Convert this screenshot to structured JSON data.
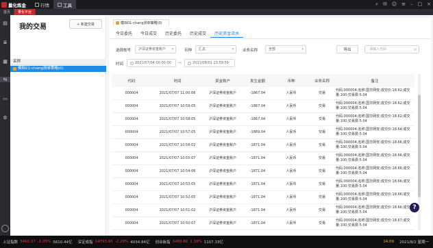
{
  "app": {
    "name": "量化炼金"
  },
  "topnav": [
    {
      "label": "行情"
    },
    {
      "label": "工具"
    }
  ],
  "doc_tabs": [
    {
      "label": "首页"
    },
    {
      "label": "量化平台"
    }
  ],
  "left_panel": {
    "title": "我的交易",
    "new_button": "+ 新建交易",
    "list_header": "名称",
    "items": [
      {
        "label": "模拟01-chang测单策略(0)"
      }
    ]
  },
  "strategy_tab": "模拟01-chang测单策略(0)",
  "subtabs": [
    "今日委托",
    "今日成交",
    "历史委托",
    "历史成交",
    "历史资金流水"
  ],
  "active_subtab": "历史资金流水",
  "filters": {
    "account_label": "选择账号",
    "account_value": "沪深证券资金账户",
    "currency_label": "币种",
    "currency_value": "汇总",
    "biz_label": "业务名称",
    "biz_value": "全部",
    "export": "导出",
    "search_placeholder": "请输入代码",
    "time_label": "时间",
    "date_from": "2021/07/04 00:00:00",
    "date_sep": "—",
    "date_to": "2021/08/01 23:59:59"
  },
  "table": {
    "headers": [
      "代码",
      "时间",
      "资金账户",
      "发生金额",
      "币种",
      "业务名称",
      "备注"
    ],
    "rows": [
      [
        "000004",
        "2021/07/07 11:00:06",
        "沪深证券资金账户",
        "-1867.04",
        "人民币",
        "交易",
        "代码:000004;名称:国华网安;成交价:18.62;成交量:100;交易费:5.04"
      ],
      [
        "000004",
        "2021/07/07 10:59:05",
        "沪深证券资金账户",
        "-1867.04",
        "人民币",
        "交易",
        "代码:000004;名称:国华网安;成交价:18.62;成交量:100;交易费:5.04"
      ],
      [
        "000004",
        "2021/07/07 10:58:05",
        "沪深证券资金账户",
        "-1867.04",
        "人民币",
        "交易",
        "代码:000004;名称:国华网安;成交价:18.62;成交量:100;交易费:5.04"
      ],
      [
        "000004",
        "2021/07/07 10:57:05",
        "沪深证券资金账户",
        "-1869.04",
        "人民币",
        "交易",
        "代码:000004;名称:国华网安;成交价:18.64;成交量:100;交易费:5.04"
      ],
      [
        "000004",
        "2021/07/07 10:56:02",
        "沪深证券资金账户",
        "-1871.04",
        "人民币",
        "交易",
        "代码:000004;名称:国华网安;成交价:18.66;成交量:100;交易费:5.04"
      ],
      [
        "000004",
        "2021/07/07 10:55:07",
        "沪深证券资金账户",
        "-1871.04",
        "人民币",
        "交易",
        "代码:000004;名称:国华网安;成交价:18.66;成交量:100;交易费:5.04"
      ],
      [
        "000004",
        "2021/07/07 10:54:06",
        "沪深证券资金账户",
        "-1871.04",
        "人民币",
        "交易",
        "代码:000004;名称:国华网安;成交价:18.66;成交量:100;交易费:5.04"
      ],
      [
        "000004",
        "2021/07/07 10:53:05",
        "沪深证券资金账户",
        "-1871.04",
        "人民币",
        "交易",
        "代码:000004;名称:国华网安;成交价:18.66;成交量:100;交易费:5.04"
      ],
      [
        "000004",
        "2021/07/07 10:52:05",
        "沪深证券资金账户",
        "-1871.04",
        "人民币",
        "交易",
        "代码:000004;名称:国华网安;成交价:18.66;成交量:100;交易费:5.04"
      ],
      [
        "000004",
        "2021/07/07 10:51:02",
        "沪深证券资金账户",
        "-1871.04",
        "人民币",
        "交易",
        "代码:000004;名称:国华网安;成交价:18.66;成交量:100;交易费:5.04"
      ],
      [
        "000004",
        "2021/07/07 10:50:07",
        "沪深证券资金账户",
        "-1871.04",
        "人民币",
        "交易",
        "代码:000004;名称:国华网安;成交价:18.67;成交量:100;交易费:5.04"
      ]
    ]
  },
  "statusbar": {
    "sh_label": "上证指数",
    "sh_value": "3460.37",
    "sh_pct": "-1.05%",
    "sh_amount": "5610.44亿",
    "sz_label": "深证成指",
    "sz_value": "14793.65",
    "sz_pct": "-2.29%",
    "sz_amount": "4034.84亿",
    "cy_label": "创业板指",
    "cy_value": "3480.86",
    "cy_pct": "1.18%",
    "cy_amount": "1107.33亿",
    "time": "14:09",
    "date": "2021/8/2 星期一"
  },
  "colors": {
    "accent": "#1a7be0",
    "brand_red": "#c7262c",
    "selection": "#1f8ce6"
  }
}
